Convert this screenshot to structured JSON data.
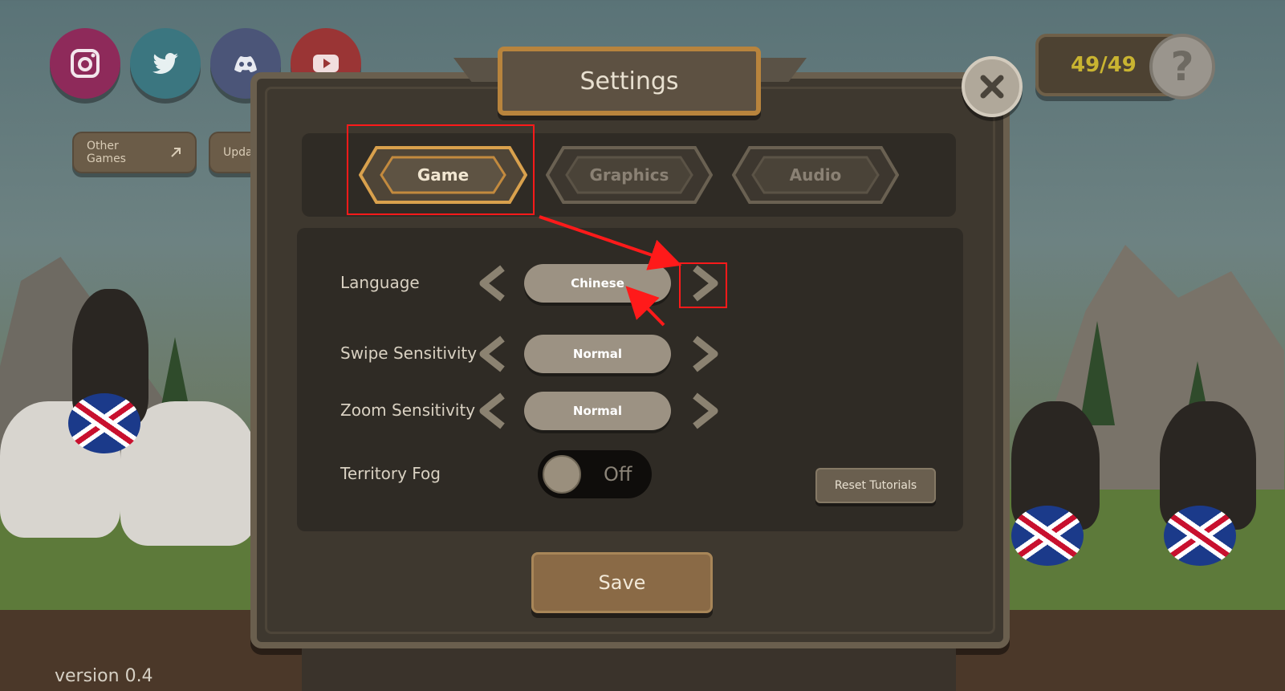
{
  "social": {
    "instagram_icon": "instagram-icon",
    "twitter_icon": "twitter-icon",
    "discord_icon": "discord-icon",
    "youtube_icon": "youtube-icon"
  },
  "links": {
    "other_games": "Other Games",
    "updates": "Upda"
  },
  "version_text": "version 0.4",
  "counter": {
    "value": "49/49"
  },
  "help": {
    "glyph": "?"
  },
  "dialog": {
    "title": "Settings",
    "tabs": [
      {
        "label": "Game",
        "active": true
      },
      {
        "label": "Graphics",
        "active": false
      },
      {
        "label": "Audio",
        "active": false
      }
    ],
    "settings": [
      {
        "label": "Language",
        "value": "Chinese"
      },
      {
        "label": "Swipe Sensitivity",
        "value": "Normal"
      },
      {
        "label": "Zoom Sensitivity",
        "value": "Normal"
      }
    ],
    "territory_fog": {
      "label": "Territory Fog",
      "state": "Off"
    },
    "reset_tutorials": "Reset Tutorials",
    "save": "Save"
  },
  "colors": {
    "accent_gold": "#b8843d",
    "annotation_red": "#ff1a1a",
    "counter_text": "#c9b431"
  }
}
